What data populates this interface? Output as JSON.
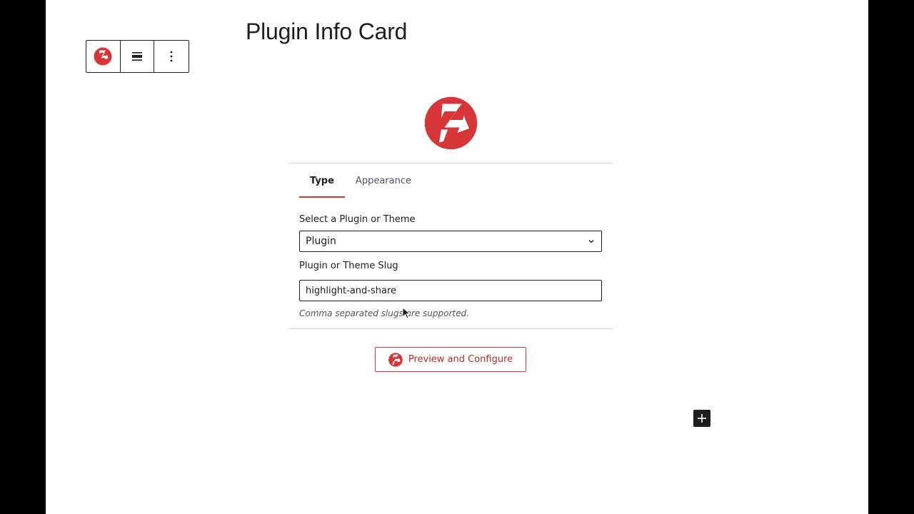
{
  "page": {
    "title": "Plugin Info Card"
  },
  "toolbar": {
    "block_icon": "plugin-info-card-logo-icon",
    "align_icon": "align-wide-icon",
    "options_icon": "more-options-icon"
  },
  "card": {
    "logo_icon": "plugin-info-card-logo-icon",
    "tabs": [
      {
        "label": "Type",
        "active": true
      },
      {
        "label": "Appearance",
        "active": false
      }
    ],
    "select_label": "Select a Plugin or Theme",
    "select_value": "Plugin",
    "slug_label": "Plugin or Theme Slug",
    "slug_value": "highlight-and-share",
    "slug_help": "Comma separated slugs are supported.",
    "preview_button_label": "Preview and Configure"
  },
  "colors": {
    "accent": "#d63638",
    "text": "#1e1e1e",
    "muted": "#50575e",
    "divider": "#dcdcde"
  }
}
